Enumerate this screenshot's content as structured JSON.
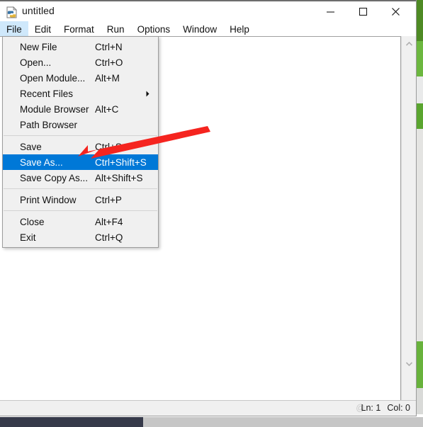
{
  "window": {
    "title": "untitled",
    "icon": "python-file-icon",
    "controls": {
      "minimize": "minimize-icon",
      "maximize": "maximize-icon",
      "close": "close-icon"
    }
  },
  "menubar": {
    "items": [
      {
        "label": "File",
        "active": true
      },
      {
        "label": "Edit",
        "active": false
      },
      {
        "label": "Format",
        "active": false
      },
      {
        "label": "Run",
        "active": false
      },
      {
        "label": "Options",
        "active": false
      },
      {
        "label": "Window",
        "active": false
      },
      {
        "label": "Help",
        "active": false
      }
    ]
  },
  "file_menu": {
    "groups": [
      {
        "items": [
          {
            "label": "New File",
            "accel": "Ctrl+N",
            "submenu": false,
            "selected": false
          },
          {
            "label": "Open...",
            "accel": "Ctrl+O",
            "submenu": false,
            "selected": false
          },
          {
            "label": "Open Module...",
            "accel": "Alt+M",
            "submenu": false,
            "selected": false
          },
          {
            "label": "Recent Files",
            "accel": "",
            "submenu": true,
            "selected": false
          },
          {
            "label": "Module Browser",
            "accel": "Alt+C",
            "submenu": false,
            "selected": false
          },
          {
            "label": "Path Browser",
            "accel": "",
            "submenu": false,
            "selected": false
          }
        ]
      },
      {
        "items": [
          {
            "label": "Save",
            "accel": "Ctrl+S",
            "submenu": false,
            "selected": false
          },
          {
            "label": "Save As...",
            "accel": "Ctrl+Shift+S",
            "submenu": false,
            "selected": true
          },
          {
            "label": "Save Copy As...",
            "accel": "Alt+Shift+S",
            "submenu": false,
            "selected": false
          }
        ]
      },
      {
        "items": [
          {
            "label": "Print Window",
            "accel": "Ctrl+P",
            "submenu": false,
            "selected": false
          }
        ]
      },
      {
        "items": [
          {
            "label": "Close",
            "accel": "Alt+F4",
            "submenu": false,
            "selected": false
          },
          {
            "label": "Exit",
            "accel": "Ctrl+Q",
            "submenu": false,
            "selected": false
          }
        ]
      }
    ]
  },
  "statusbar": {
    "line": "Ln: 1",
    "column": "Col: 0",
    "watermark": "@"
  },
  "scrollbar": {
    "up_arrow": "chevron-up-icon",
    "down_arrow": "chevron-down-icon"
  },
  "annotation": {
    "arrow_color": "#f5241f",
    "points_to": "Save As..."
  },
  "colors": {
    "menu_highlight": "#0078d7",
    "menubar_active": "#cfe8fb",
    "menu_background": "#f0f0f0",
    "desktop_green": "#6cb73f",
    "taskbar_dark": "#363a4a"
  }
}
